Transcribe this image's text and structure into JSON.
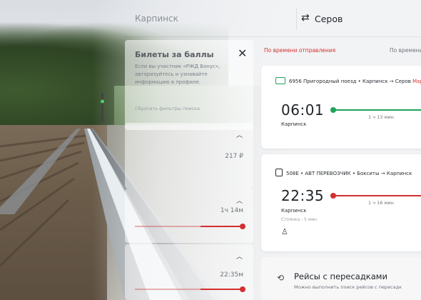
{
  "search": {
    "from": "Карпинск",
    "swap_icon": "swap-arrows-icon",
    "to": "Серов"
  },
  "sidebar": {
    "bonus_title": "Билеты за баллы",
    "bonus_text": "Если вы участник «РЖД Бонус», авторизуйтесь и узнавайте информацию в профиле.",
    "close_icon": "close-icon",
    "filters_link": "Сбросить фильтры поиска",
    "price_value": "217 ₽",
    "duration_value": "1ч 14м",
    "departure_value": "22:35м"
  },
  "sort": {
    "active": "По времени отправления",
    "other": "По времени"
  },
  "trips": [
    {
      "number_type": "6956 Пригородный поезд",
      "route_from": "Карпинск",
      "route_to": "Серов",
      "route_extra": "Мар",
      "time": "06:01",
      "station": "Карпинск",
      "duration": "1 ч 13 мин",
      "color": "#1fa35a"
    },
    {
      "number_type": "508Е • АВТ ПЕРЕВОЗЧИК",
      "route_from": "Бокситы",
      "route_to": "Карпинск",
      "time": "22:35",
      "station": "Карпинск",
      "stop": "Стоянка : 5 мин",
      "duration": "1 ч 16 мин",
      "color": "#d32f2f"
    }
  ],
  "transfer": {
    "title": "Рейсы с пересадками",
    "subtitle": "Можно выполнить поиск рейсов с пересадк"
  }
}
